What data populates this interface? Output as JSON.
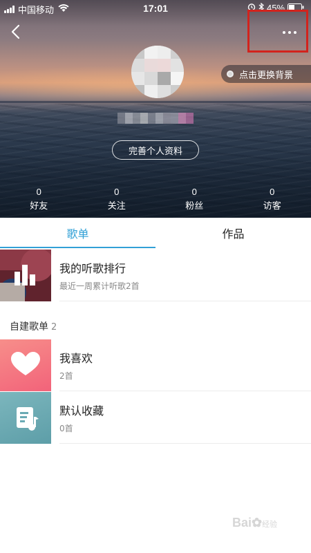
{
  "status_bar": {
    "carrier": "中国移动",
    "time": "17:01",
    "battery": "45%"
  },
  "header": {
    "back_icon": "chevron-left-icon",
    "more_icon": "more-horizontal-icon",
    "change_background_label": "点击更换背景",
    "edit_profile_label": "完善个人资料",
    "highlight_color": "#d2231d"
  },
  "stats": [
    {
      "value": "0",
      "label": "好友"
    },
    {
      "value": "0",
      "label": "关注"
    },
    {
      "value": "0",
      "label": "粉丝"
    },
    {
      "value": "0",
      "label": "访客"
    }
  ],
  "tabs": [
    {
      "label": "歌单",
      "active": true
    },
    {
      "label": "作品",
      "active": false
    }
  ],
  "accent_color": "#31a0d6",
  "ranking": {
    "title": "我的听歌排行",
    "subtitle": "最近一周累计听歌2首"
  },
  "custom_playlists": {
    "section_title": "自建歌单",
    "count": "2",
    "items": [
      {
        "name": "我喜欢",
        "count": "2首",
        "icon": "heart-icon",
        "color": "#f56b78"
      },
      {
        "name": "默认收藏",
        "count": "0首",
        "icon": "music-note-list-icon",
        "color": "#6aaab4"
      }
    ]
  },
  "watermark": {
    "text": "Bai",
    "suffix": "经验"
  }
}
